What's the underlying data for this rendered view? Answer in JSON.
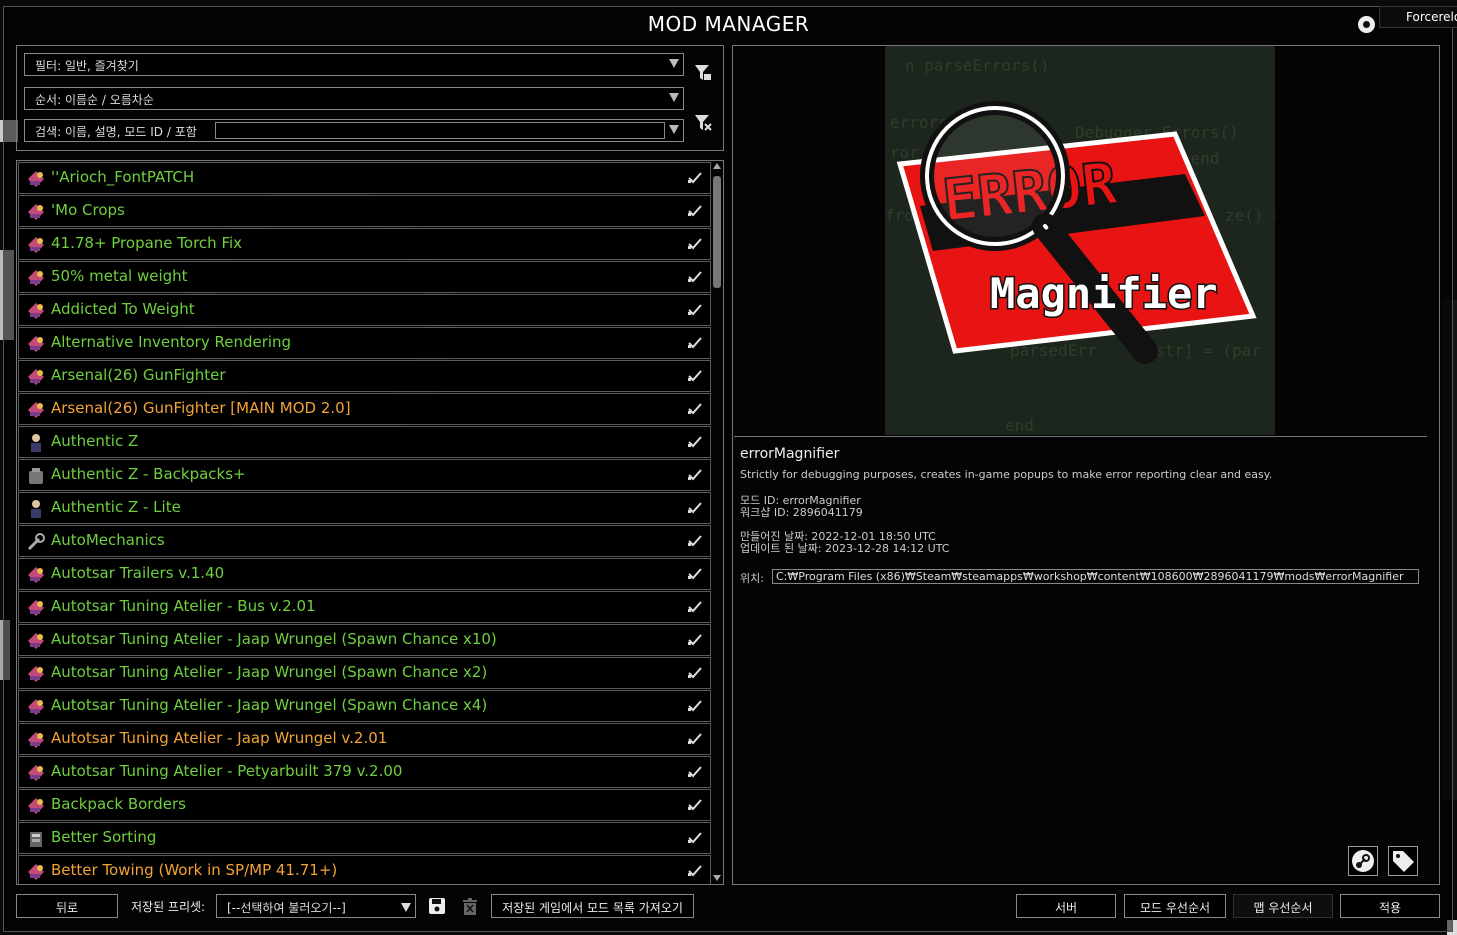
{
  "window": {
    "title": "MOD MANAGER",
    "tooltip": "Forcereload"
  },
  "filters": {
    "filter_label": "필터: 일반, 즐겨찾기",
    "order_label": "순서: 이름순 / 오름차순",
    "search_label": "검색: 이름, 설명, 모드 ID / 포함",
    "search_value": ""
  },
  "mods": [
    {
      "name": "''Arioch_FontPATCH",
      "color": "green",
      "icon": "mod-icon"
    },
    {
      "name": "'Mo Crops",
      "color": "green",
      "icon": "mod-icon"
    },
    {
      "name": "41.78+ Propane Torch Fix",
      "color": "green",
      "icon": "mod-icon"
    },
    {
      "name": "50% metal weight",
      "color": "green",
      "icon": "mod-icon"
    },
    {
      "name": "Addicted To Weight",
      "color": "green",
      "icon": "mod-icon"
    },
    {
      "name": "Alternative Inventory Rendering",
      "color": "green",
      "icon": "mod-icon"
    },
    {
      "name": "Arsenal(26) GunFighter",
      "color": "green",
      "icon": "mod-icon"
    },
    {
      "name": "Arsenal(26) GunFighter [MAIN MOD 2.0]",
      "color": "orange",
      "icon": "mod-icon"
    },
    {
      "name": "Authentic Z",
      "color": "green",
      "icon": "person-icon"
    },
    {
      "name": "Authentic Z - Backpacks+",
      "color": "green",
      "icon": "backpack-icon"
    },
    {
      "name": "Authentic Z - Lite",
      "color": "green",
      "icon": "person-icon"
    },
    {
      "name": "AutoMechanics",
      "color": "green",
      "icon": "wrench-icon"
    },
    {
      "name": "Autotsar Trailers v.1.40",
      "color": "green",
      "icon": "mod-icon"
    },
    {
      "name": "Autotsar Tuning Atelier - Bus v.2.01",
      "color": "green",
      "icon": "mod-icon"
    },
    {
      "name": "Autotsar Tuning Atelier - Jaap Wrungel (Spawn Chance x10)",
      "color": "green",
      "icon": "mod-icon"
    },
    {
      "name": "Autotsar Tuning Atelier - Jaap Wrungel (Spawn Chance x2)",
      "color": "green",
      "icon": "mod-icon"
    },
    {
      "name": "Autotsar Tuning Atelier - Jaap Wrungel (Spawn Chance x4)",
      "color": "green",
      "icon": "mod-icon"
    },
    {
      "name": "Autotsar Tuning Atelier - Jaap Wrungel v.2.01",
      "color": "orange",
      "icon": "mod-icon"
    },
    {
      "name": "Autotsar Tuning Atelier - Petyarbuilt 379 v.2.00",
      "color": "green",
      "icon": "mod-icon"
    },
    {
      "name": "Backpack Borders",
      "color": "green",
      "icon": "mod-icon"
    },
    {
      "name": "Better Sorting",
      "color": "green",
      "icon": "sorting-icon"
    },
    {
      "name": "Better Towing (Work in SP/MP 41.71+)",
      "color": "orange",
      "icon": "mod-icon"
    }
  ],
  "detail": {
    "preview_code_lines": [
      "n parseErrors()",
      "errors",
      "ror",
      "Debugger Errors()",
      "then return end",
      "ze() do",
      "fror",
      "parsedErr",
      "str] = (par",
      "end"
    ],
    "preview_err_text": "ERROR",
    "preview_magnifier_text": "Magnifier",
    "name": "errorMagnifier",
    "description": "Strictly for debugging purposes, creates in-game popups to make error reporting clear and easy.",
    "mod_id": "모드 ID: errorMagnifier",
    "workshop_id": "워크샵 ID: 2896041179",
    "created": "만들어진 날짜: 2022-12-01 18:50 UTC",
    "updated": "업데이트 된 날짜: 2023-12-28 14:12 UTC",
    "location_label": "위치:",
    "location_value": "C:₩Program Files (x86)₩Steam₩steamapps₩workshop₩content₩108600₩2896041179₩mods₩errorMagnifier"
  },
  "bottom": {
    "back": "뒤로",
    "preset_label": "저장된 프리셋:",
    "preset_value": "[--선택하여 불러오기--]",
    "import_from_save": "저장된 게임에서 모드 목록 가져오기",
    "server": "서버",
    "mod_order": "모드 우선순서",
    "map_order": "맵 우선순서",
    "apply": "적용"
  },
  "colors": {
    "green": "#6fcf3f",
    "orange": "#f2a236",
    "error_red": "#e81313"
  }
}
